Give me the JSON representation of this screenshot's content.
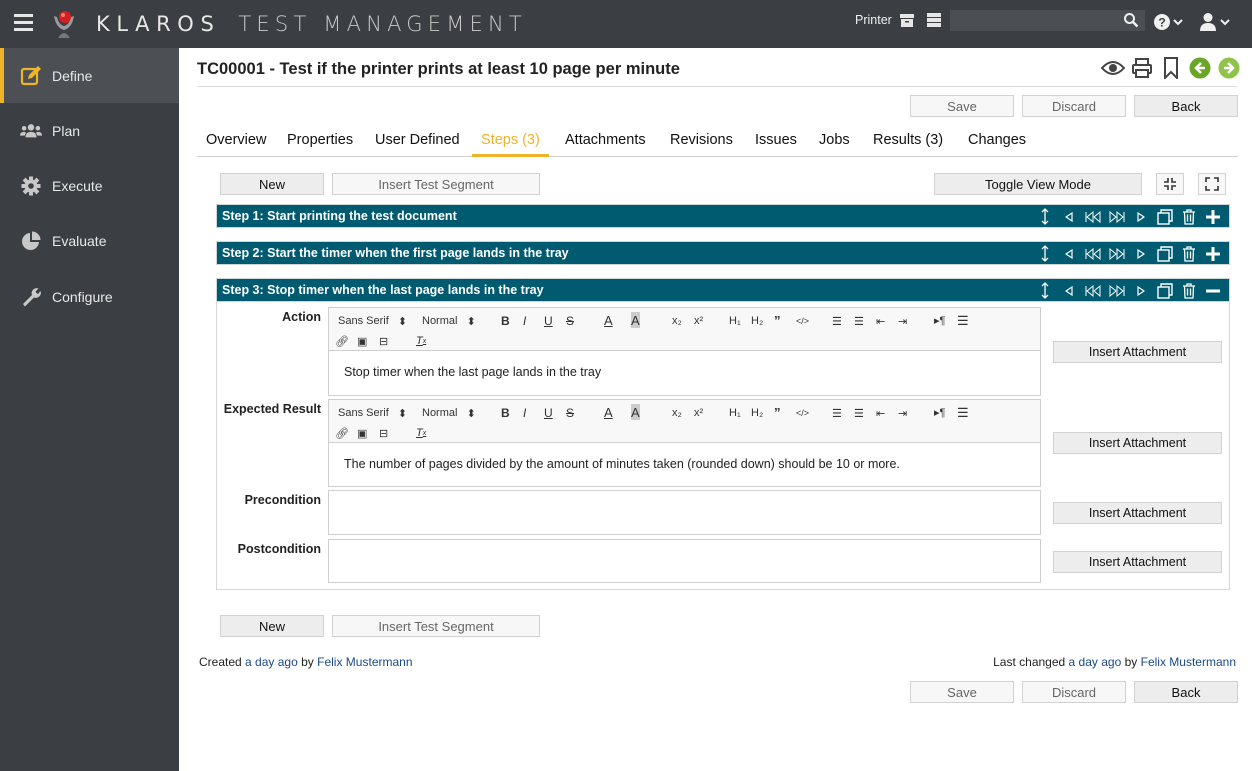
{
  "app": {
    "brand": "KLAROS",
    "brand_sub": "TEST MANAGEMENT",
    "project": "Printer",
    "search_placeholder": ""
  },
  "sidebar": {
    "items": [
      {
        "label": "Define",
        "icon": "edit-icon",
        "active": true
      },
      {
        "label": "Plan",
        "icon": "users-icon"
      },
      {
        "label": "Execute",
        "icon": "gear-icon"
      },
      {
        "label": "Evaluate",
        "icon": "pie-chart-icon"
      },
      {
        "label": "Configure",
        "icon": "wrench-icon"
      }
    ]
  },
  "page": {
    "title": "TC00001 - Test if the printer prints at least 10 page per minute",
    "buttons": {
      "save": "Save",
      "discard": "Discard",
      "back": "Back"
    }
  },
  "tabs": [
    {
      "label": "Overview"
    },
    {
      "label": "Properties"
    },
    {
      "label": "User Defined"
    },
    {
      "label": "Steps (3)",
      "active": true
    },
    {
      "label": "Attachments"
    },
    {
      "label": "Revisions"
    },
    {
      "label": "Issues"
    },
    {
      "label": "Jobs"
    },
    {
      "label": "Results (3)"
    },
    {
      "label": "Changes"
    }
  ],
  "steps_toolbar": {
    "new": "New",
    "insert_segment": "Insert Test Segment",
    "toggle_view": "Toggle View Mode"
  },
  "steps": [
    {
      "title": "Step 1: Start printing the test document",
      "expanded": false
    },
    {
      "title": "Step 2: Start the timer when the first page lands in the tray",
      "expanded": false
    },
    {
      "title": "Step 3: Stop timer when the last page lands in the tray",
      "expanded": true
    }
  ],
  "step_detail": {
    "action_label": "Action",
    "action_text": "Stop timer when the last page lands in the tray",
    "expected_label": "Expected Result",
    "expected_text": "The number of pages divided by the amount of minutes taken (rounded down) should be 10 or more.",
    "precondition_label": "Precondition",
    "precondition_text": "",
    "postcondition_label": "Postcondition",
    "postcondition_text": "",
    "insert_attachment": "Insert Attachment",
    "font_select": "Sans Serif",
    "size_select": "Normal"
  },
  "footer": {
    "created_prefix": "Created",
    "created_when": "a day ago",
    "created_by_word": "by",
    "created_by": "Felix Mustermann",
    "changed_prefix": "Last changed",
    "changed_when": "a day ago",
    "changed_by_word": "by",
    "changed_by": "Felix Mustermann"
  }
}
